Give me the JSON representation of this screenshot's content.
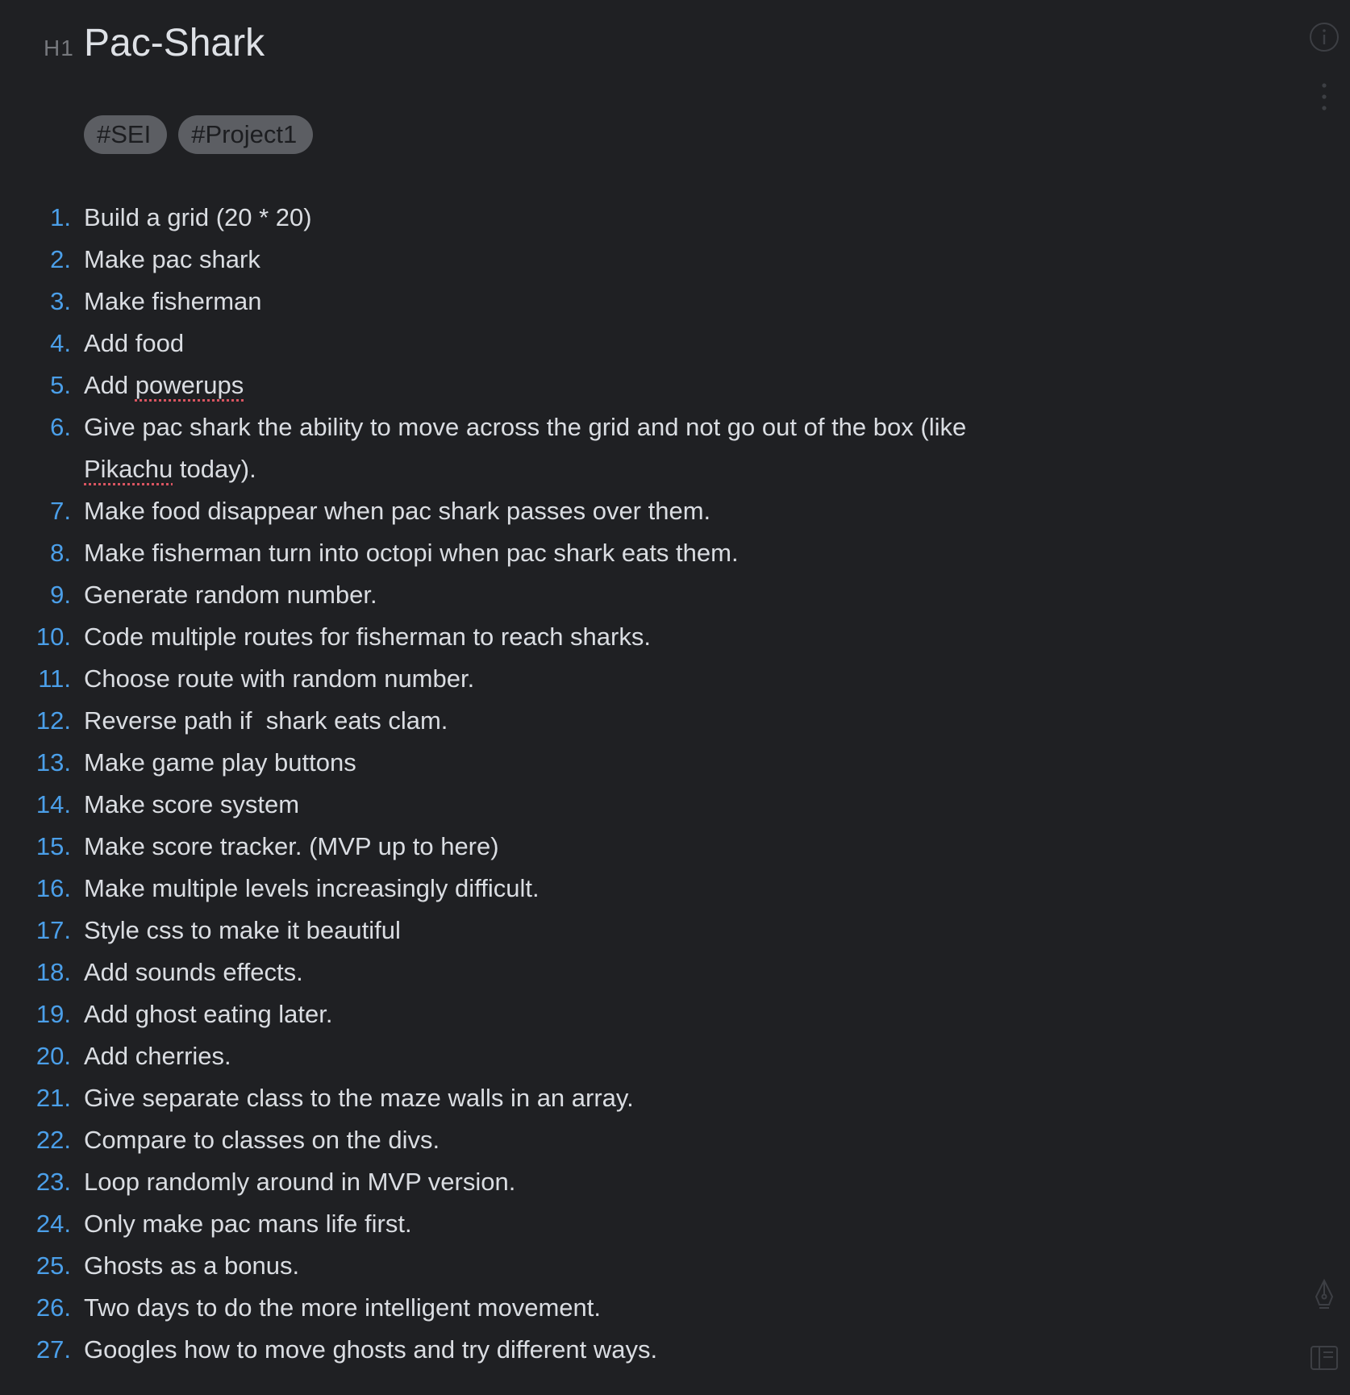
{
  "note": {
    "heading_marker": "H1",
    "title": "Pac-Shark",
    "tags": [
      "#SEI",
      "#Project1"
    ],
    "items": [
      {
        "number": "1.",
        "parts": [
          {
            "t": "Build a grid (20 * 20)"
          }
        ]
      },
      {
        "number": "2.",
        "parts": [
          {
            "t": "Make pac shark"
          }
        ]
      },
      {
        "number": "3.",
        "parts": [
          {
            "t": "Make fisherman"
          }
        ]
      },
      {
        "number": "4.",
        "parts": [
          {
            "t": "Add food"
          }
        ]
      },
      {
        "number": "5.",
        "parts": [
          {
            "t": "Add "
          },
          {
            "t": "powerups",
            "spell": true
          }
        ]
      },
      {
        "number": "6.",
        "parts": [
          {
            "t": "Give pac shark the ability to move across the grid and not go out of the box (like "
          },
          {
            "t": "Pikachu",
            "spell": true
          },
          {
            "t": " today)."
          }
        ]
      },
      {
        "number": "7.",
        "parts": [
          {
            "t": "Make food disappear when pac shark passes over them."
          }
        ]
      },
      {
        "number": "8.",
        "parts": [
          {
            "t": "Make fisherman turn into octopi when pac shark eats them."
          }
        ]
      },
      {
        "number": "9.",
        "parts": [
          {
            "t": "Generate random number."
          }
        ]
      },
      {
        "number": "10.",
        "parts": [
          {
            "t": "Code multiple routes for fisherman to reach sharks."
          }
        ]
      },
      {
        "number": "11.",
        "parts": [
          {
            "t": "Choose route with random number."
          }
        ]
      },
      {
        "number": "12.",
        "parts": [
          {
            "t": "Reverse path if  shark eats clam."
          }
        ]
      },
      {
        "number": "13.",
        "parts": [
          {
            "t": "Make game play buttons"
          }
        ]
      },
      {
        "number": "14.",
        "parts": [
          {
            "t": "Make score system"
          }
        ]
      },
      {
        "number": "15.",
        "parts": [
          {
            "t": "Make score tracker. (MVP up to here)"
          }
        ]
      },
      {
        "number": "16.",
        "parts": [
          {
            "t": "Make multiple levels increasingly difficult."
          }
        ]
      },
      {
        "number": "17.",
        "parts": [
          {
            "t": "Style css to make it beautiful"
          }
        ]
      },
      {
        "number": "18.",
        "parts": [
          {
            "t": "Add sounds effects."
          }
        ]
      },
      {
        "number": "19.",
        "parts": [
          {
            "t": "Add ghost eating later."
          }
        ]
      },
      {
        "number": "20.",
        "parts": [
          {
            "t": "Add cherries."
          }
        ]
      },
      {
        "number": "21.",
        "parts": [
          {
            "t": "Give separate class to the maze walls in an array."
          }
        ]
      },
      {
        "number": "22.",
        "parts": [
          {
            "t": "Compare to classes on the divs."
          }
        ]
      },
      {
        "number": "23.",
        "parts": [
          {
            "t": "Loop randomly around in MVP version."
          }
        ]
      },
      {
        "number": "24.",
        "parts": [
          {
            "t": "Only make pac mans life first."
          }
        ]
      },
      {
        "number": "25.",
        "parts": [
          {
            "t": "Ghosts as a bonus."
          }
        ]
      },
      {
        "number": "26.",
        "parts": [
          {
            "t": "Two days to do the more intelligent movement."
          }
        ]
      },
      {
        "number": "27.",
        "parts": [
          {
            "t": "Googles how to move ghosts and try different ways."
          }
        ]
      }
    ]
  },
  "sidebar_icons": [
    "info-icon",
    "more-vertical-icon",
    "pen-nib-icon",
    "sidebar-toggle-icon"
  ],
  "colors": {
    "background": "#1f2023",
    "text": "#dadde2",
    "list_number": "#4b9fe9",
    "tag_background": "#5c5e63",
    "tag_text": "#1c1d20",
    "spellcheck_underline": "#d95561"
  }
}
